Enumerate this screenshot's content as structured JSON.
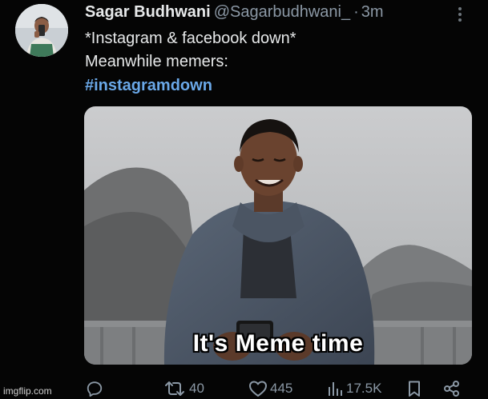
{
  "author": {
    "name": "Sagar Budhwani",
    "handle": "@Sagarbudhwani_",
    "separator": "·",
    "time": "3m"
  },
  "tweet": {
    "line1": "*Instagram & facebook down*",
    "line2": "Meanwhile memers:",
    "hashtag": "#instagramdown"
  },
  "media": {
    "caption": "It's Meme time"
  },
  "actions": {
    "reply_icon": "reply-icon",
    "retweets": "40",
    "likes": "445",
    "views": "17.5K",
    "bookmark_icon": "bookmark-icon",
    "share_icon": "share-icon"
  },
  "watermark": "imgflip.com",
  "colors": {
    "background": "#050505",
    "text": "#e7e9ea",
    "muted": "#8b98a5",
    "hashtag": "#6aa8e8"
  }
}
